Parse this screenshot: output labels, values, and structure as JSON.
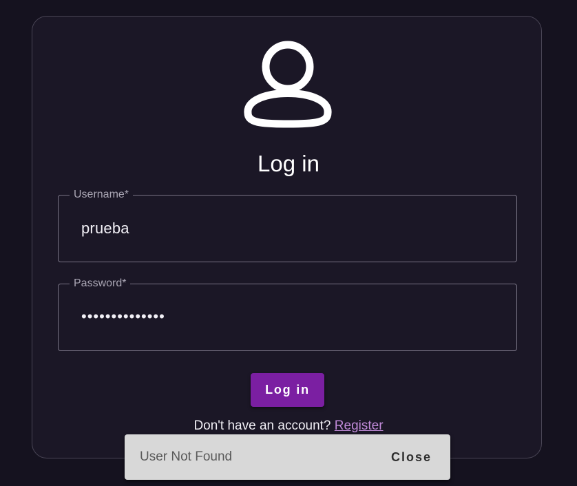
{
  "login": {
    "avatar_icon": "user-icon",
    "title": "Log in",
    "username": {
      "label": "Username*",
      "value": "prueba"
    },
    "password": {
      "label": "Password*",
      "value": "••••••••••••••"
    },
    "submit_label": "Log in",
    "register_prompt": "Don't have an account?",
    "register_link": "Register"
  },
  "snackbar": {
    "message": "User Not Found",
    "close_label": "Close"
  },
  "colors": {
    "background": "#15121f",
    "card": "#1b1726",
    "primary": "#7b1fa2",
    "link": "#c18bd9",
    "snackbar": "#d8d8d8"
  }
}
